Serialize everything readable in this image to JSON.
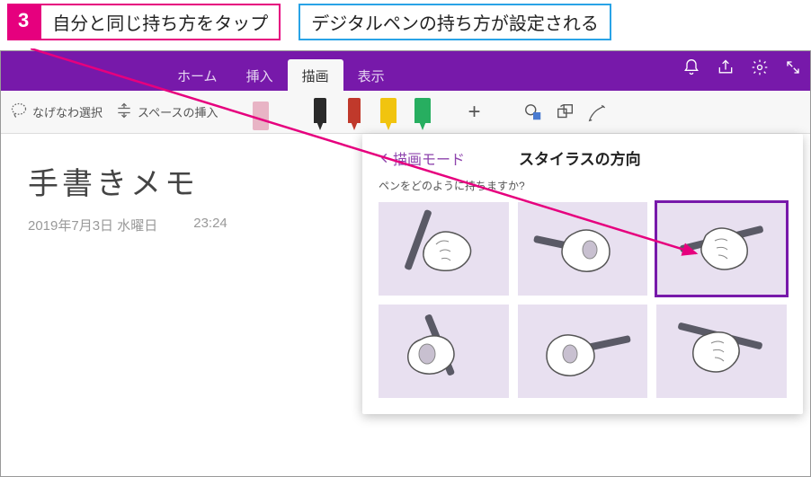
{
  "callouts": {
    "step_number": "3",
    "instruction": "自分と同じ持ち方をタップ",
    "result": "デジタルペンの持ち方が設定される"
  },
  "tabs": {
    "home": "ホーム",
    "insert": "挿入",
    "draw": "描画",
    "view": "表示"
  },
  "toolbar": {
    "lasso": "なげなわ選択",
    "insert_space": "スペースの挿入"
  },
  "note": {
    "title": "手書きメモ",
    "date": "2019年7月3日 水曜日",
    "time": "23:24"
  },
  "stylus_panel": {
    "back": "描画モード",
    "title": "スタイラスの方向",
    "question": "ペンをどのように持ちますか?",
    "selected_index": 2
  },
  "colors": {
    "brand": "#7719aa",
    "accent_pink": "#e6007e",
    "accent_blue": "#29a3e6"
  }
}
